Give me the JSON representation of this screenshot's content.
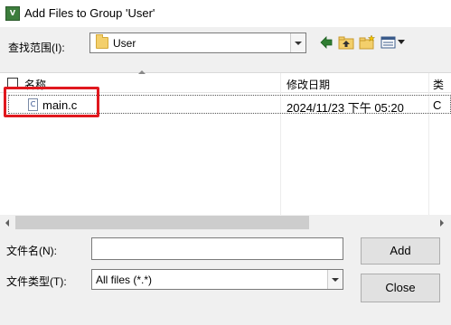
{
  "window": {
    "title": "Add Files to Group 'User'",
    "icon": "uv-app-icon"
  },
  "lookin": {
    "label": "查找范围(I):",
    "value": "User"
  },
  "toolbar": {
    "icons": [
      "back-icon",
      "up-folder-icon",
      "new-folder-icon",
      "view-menu-icon"
    ]
  },
  "columns": {
    "name": "名称",
    "date": "修改日期",
    "type": "类"
  },
  "files": [
    {
      "icon_text": "C",
      "name": "main.c",
      "date": "2024/11/23 下午 05:20",
      "type": "C"
    }
  ],
  "form": {
    "filename_label": "文件名(N):",
    "filename_value": "",
    "filetype_label": "文件类型(T):",
    "filetype_value": "All files (*.*)"
  },
  "buttons": {
    "add": "Add",
    "close": "Close"
  },
  "colors": {
    "highlight": "#e0181e"
  }
}
